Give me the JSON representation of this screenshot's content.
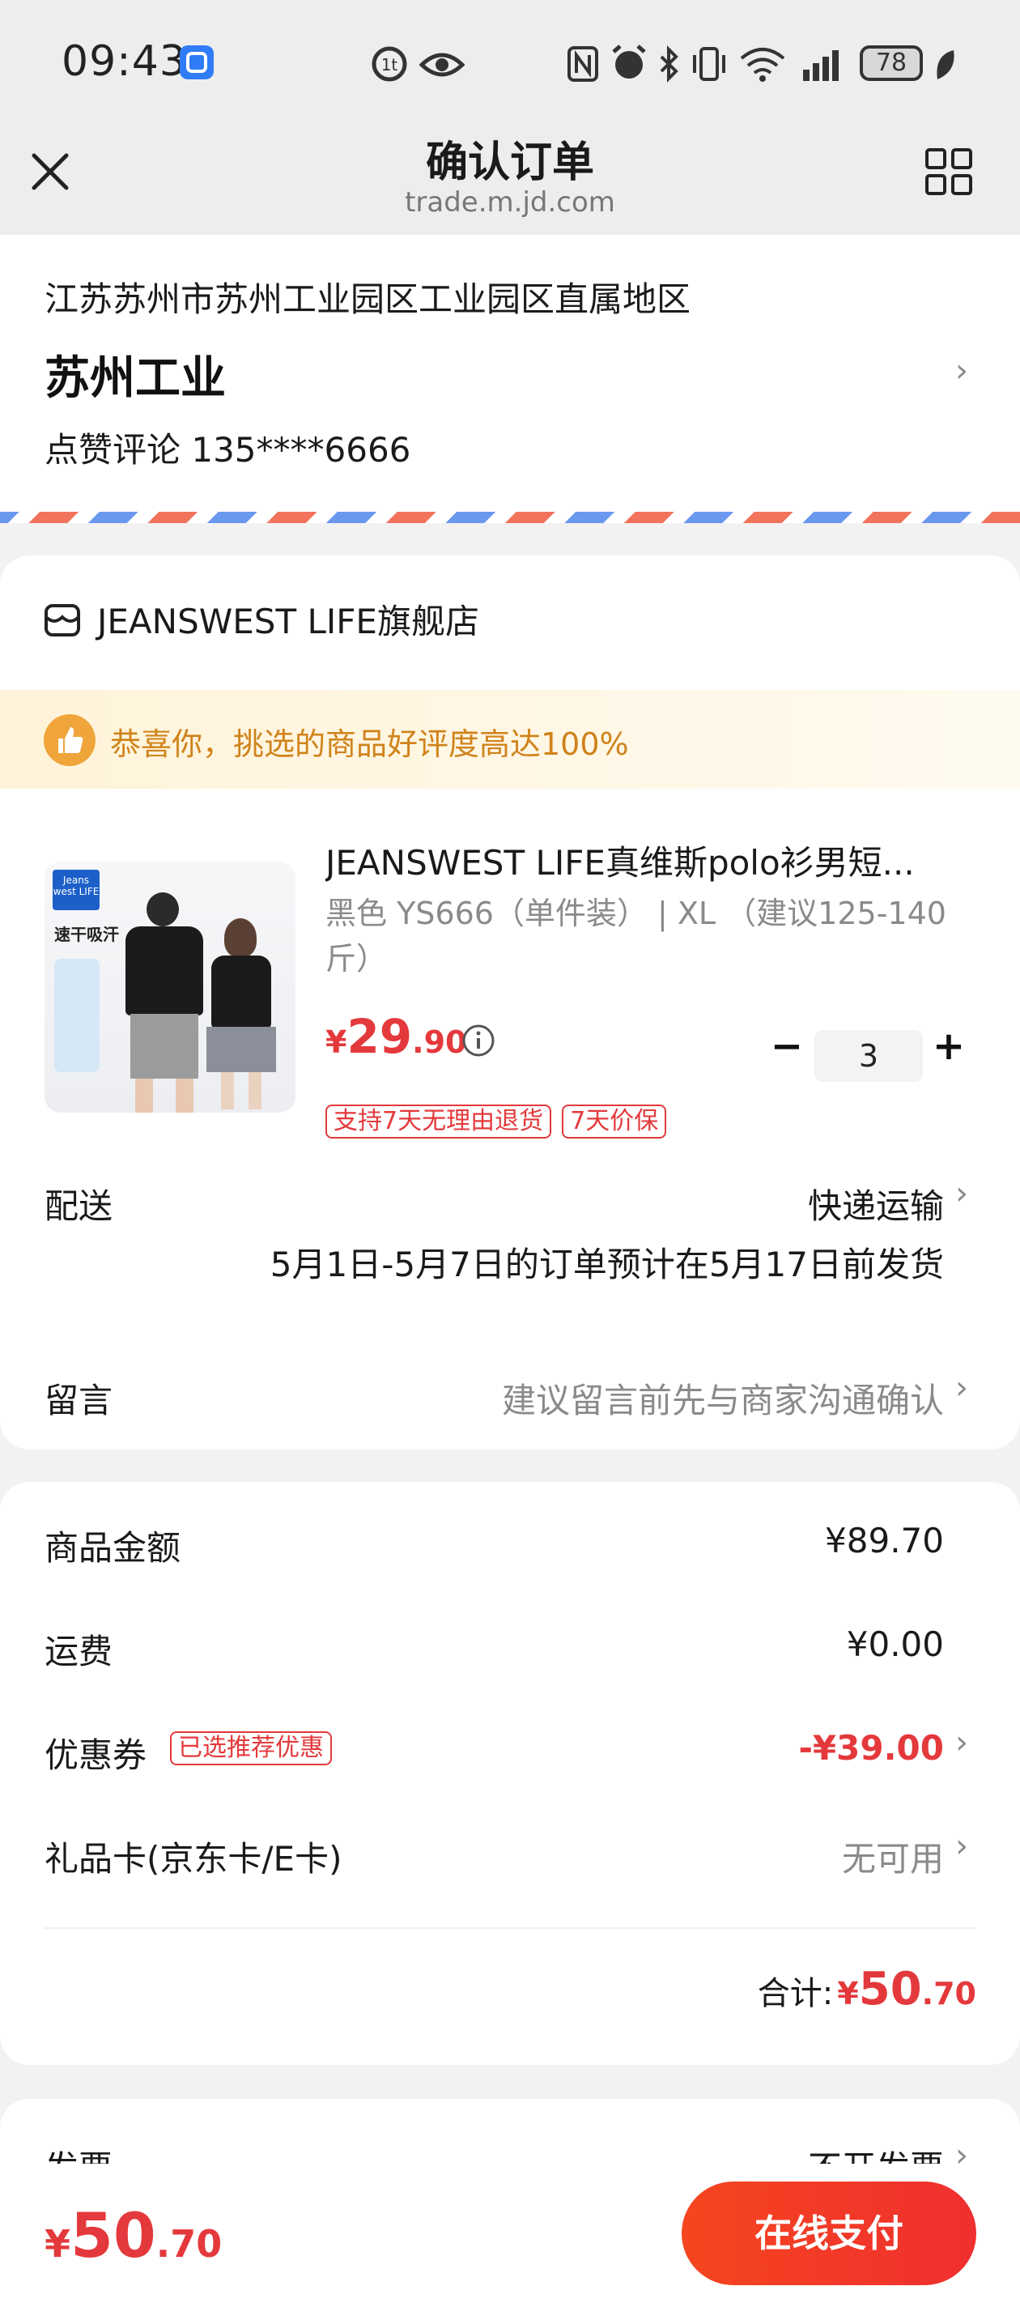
{
  "status_bar": {
    "time": "09:43",
    "battery": "78"
  },
  "nav": {
    "title": "确认订单",
    "url": "trade.m.jd.com"
  },
  "address": {
    "region": "江苏苏州市苏州工业园区工业园区直属地区",
    "detail": "苏州工业",
    "contact": "点赞评论 135****6666"
  },
  "store": {
    "name": "JEANSWEST LIFE旗舰店",
    "banner": "恭喜你，挑选的商品好评度高达100%"
  },
  "product": {
    "title": "JEANSWEST LIFE真维斯polo衫男短...",
    "spec": "黑色 YS666（单件装） | XL （建议125-140斤）",
    "currency": "¥",
    "price_int": "29",
    "price_dec": ".90",
    "quantity": "3",
    "minus": "−",
    "plus": "+",
    "tags": [
      "支持7天无理由退货",
      "7天价保"
    ],
    "image_text": "速干吸汗",
    "image_brand": "Jeans west LIFE"
  },
  "delivery": {
    "label": "配送",
    "value": "快递运输",
    "note": "5月1日-5月7日的订单预计在5月17日前发货"
  },
  "message": {
    "label": "留言",
    "placeholder": "建议留言前先与商家沟通确认"
  },
  "summary": {
    "goods_label": "商品金额",
    "goods_value": "¥89.70",
    "shipping_label": "运费",
    "shipping_value": "¥0.00",
    "coupon_label": "优惠券",
    "coupon_tag": "已选推荐优惠",
    "coupon_value": "-¥39.00",
    "giftcard_label": "礼品卡(京东卡/E卡)",
    "giftcard_value": "无可用",
    "total_label": "合计:",
    "total_currency": "¥",
    "total_int": "50",
    "total_dec": ".70"
  },
  "invoice": {
    "label": "发票",
    "value": "不开发票"
  },
  "bottom_bar": {
    "currency": "¥",
    "amount_int": "50",
    "amount_dec": ".70",
    "pay_label": "在线支付"
  },
  "colors": {
    "accent_red": "#e4393c",
    "pay_button": "#f43f1f",
    "banner_bg": "#fff6e0",
    "banner_text": "#d0831a"
  }
}
